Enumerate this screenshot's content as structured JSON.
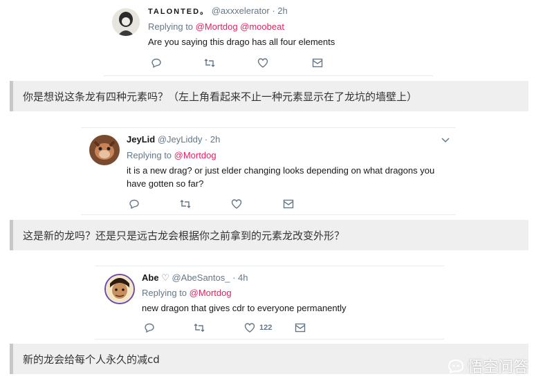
{
  "tweets": [
    {
      "name": "TALONTED。",
      "handle": "@axxxelerator · 2h",
      "replying_prefix": "Replying to ",
      "mentions": "@Mortdog @moobeat",
      "text": "Are you saying this drago has all four elements",
      "like_count": ""
    },
    {
      "name": "JeyLid",
      "handle": "@JeyLiddy · 2h",
      "replying_prefix": "Replying to ",
      "mentions": "@Mortdog",
      "text": "it is a new drag? or just elder changing looks depending on what dragons you have gotten so far?",
      "like_count": ""
    },
    {
      "name": "Abe",
      "handle": "♡ @AbeSantos_ · 4h",
      "replying_prefix": "Replying to ",
      "mentions": "@Mortdog",
      "text": "new dragon that gives cdr to everyone permanently",
      "like_count": "122"
    }
  ],
  "captions": [
    "你是想说这条龙有四种元素吗？（左上角看起来不止一种元素显示在了龙坑的墙壁上）",
    "这是新的龙吗？还是只是远古龙会根据你之前拿到的元素龙改变外形？",
    "新的龙会给每个人永久的减cd"
  ],
  "watermark": "悟空问答",
  "colors": {
    "mention": "#e0245e",
    "secondary_text": "#657786",
    "caption_bg": "#efefef",
    "caption_bar": "#c8c8c8"
  },
  "icons": [
    "reply-icon",
    "retweet-icon",
    "like-icon",
    "dm-icon",
    "chevron-down-icon"
  ]
}
